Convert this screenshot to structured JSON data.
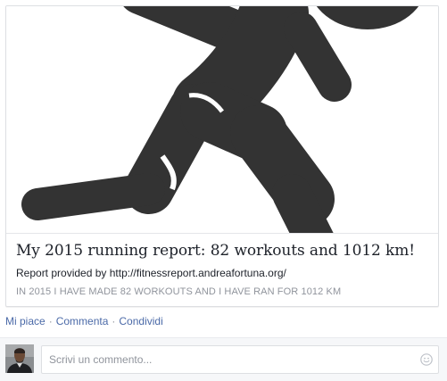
{
  "link_card": {
    "image_icon": "running-person-icon",
    "title": "My 2015 running report: 82 workouts and 1012 km!",
    "description": "Report provided by http://fitnessreport.andreafortuna.org/",
    "source_text": "IN 2015 I HAVE MADE 82 WORKOUTS AND I HAVE RAN FOR 1012 KM"
  },
  "actions": {
    "like": "Mi piace",
    "separator": "·",
    "comment": "Commenta",
    "share": "Condividi"
  },
  "comment_composer": {
    "avatar": "user-avatar",
    "placeholder": "Scrivi un commento...",
    "emoji_icon": "smiley-icon"
  },
  "colors": {
    "link": "#4b6aa8",
    "muted": "#90949c",
    "text": "#1d2129",
    "figure": "#333333",
    "border": "#dddfe2"
  }
}
